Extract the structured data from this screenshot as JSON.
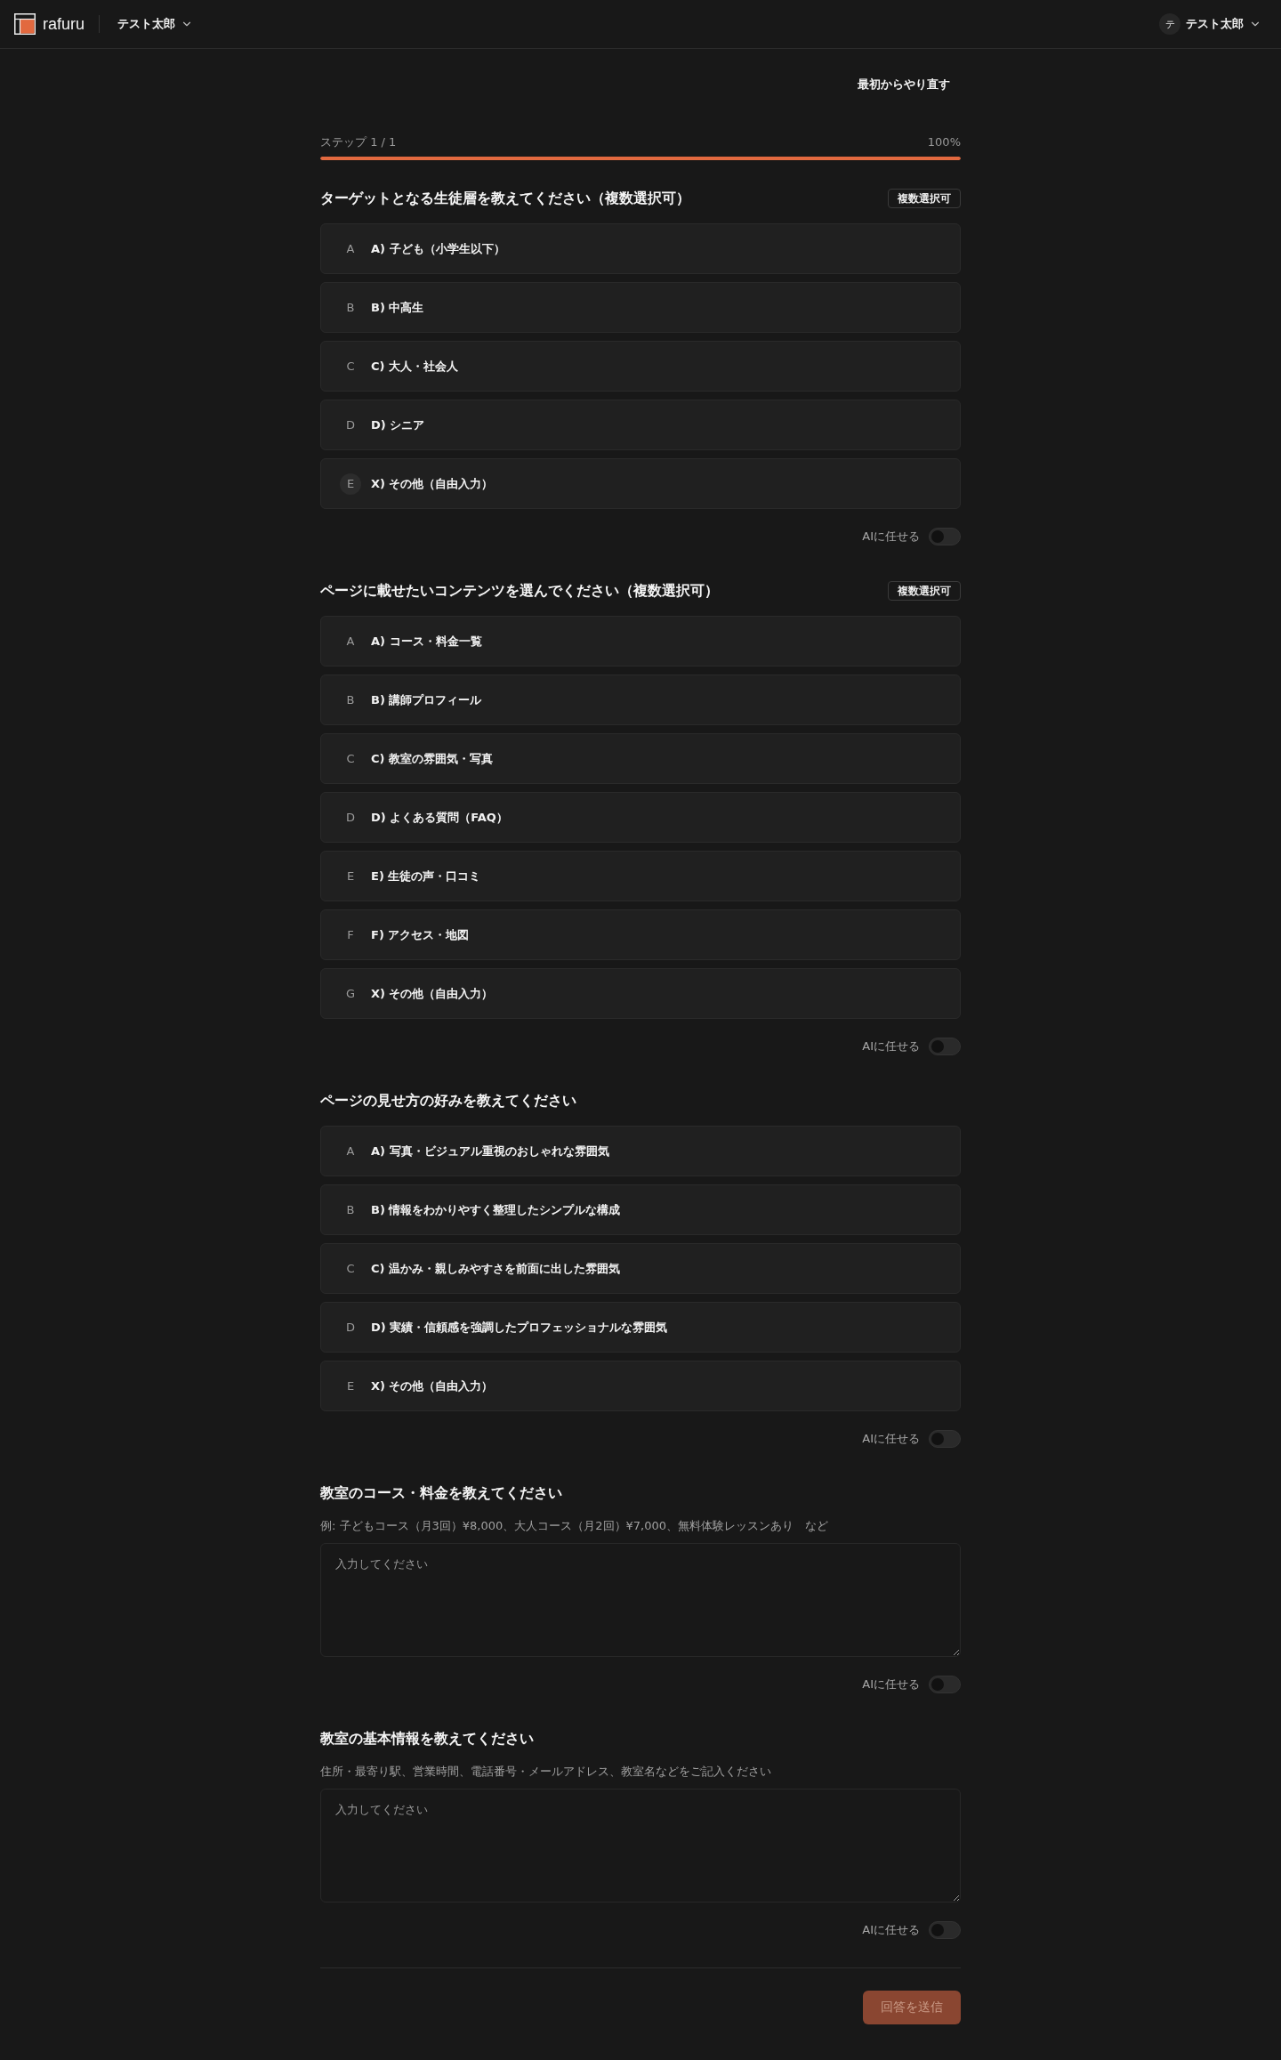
{
  "header": {
    "logo_text": "rafuru",
    "workspace": "テスト太郎",
    "user": {
      "initial": "テ",
      "name": "テスト太郎"
    }
  },
  "restart_button": "最初からやり直す",
  "progress": {
    "label": "ステップ 1 / 1",
    "percent": "100%",
    "level": 1
  },
  "questions": [
    {
      "kind": "choice",
      "title": "ターゲットとなる生徒層を教えてください（複数選択可）",
      "badge": "複数選択可",
      "options": [
        {
          "letter": "A",
          "text": "A) 子ども（小学生以下）",
          "selected": false,
          "hovered": false
        },
        {
          "letter": "B",
          "text": "B) 中高生",
          "selected": false,
          "hovered": false
        },
        {
          "letter": "C",
          "text": "C) 大人・社会人",
          "selected": false,
          "hovered": false
        },
        {
          "letter": "D",
          "text": "D) シニア",
          "selected": false,
          "hovered": false
        },
        {
          "letter": "E",
          "text": "X) その他（自由入力）",
          "selected": false,
          "hovered": true
        }
      ],
      "ai_toggle": {
        "label": "AIに任せる",
        "on": false
      }
    },
    {
      "kind": "choice",
      "title": "ページに載せたいコンテンツを選んでください（複数選択可）",
      "badge": "複数選択可",
      "options": [
        {
          "letter": "A",
          "text": "A) コース・料金一覧",
          "selected": false
        },
        {
          "letter": "B",
          "text": "B) 講師プロフィール",
          "selected": false
        },
        {
          "letter": "C",
          "text": "C) 教室の雰囲気・写真",
          "selected": false
        },
        {
          "letter": "D",
          "text": "D) よくある質問（FAQ）",
          "selected": false
        },
        {
          "letter": "E",
          "text": "E) 生徒の声・口コミ",
          "selected": false
        },
        {
          "letter": "F",
          "text": "F) アクセス・地図",
          "selected": false
        },
        {
          "letter": "G",
          "text": "X) その他（自由入力）",
          "selected": false
        }
      ],
      "ai_toggle": {
        "label": "AIに任せる",
        "on": false
      }
    },
    {
      "kind": "choice",
      "title": "ページの見せ方の好みを教えてください",
      "options": [
        {
          "letter": "A",
          "text": "A) 写真・ビジュアル重視のおしゃれな雰囲気",
          "selected": false
        },
        {
          "letter": "B",
          "text": "B) 情報をわかりやすく整理したシンプルな構成",
          "selected": false
        },
        {
          "letter": "C",
          "text": "C) 温かみ・親しみやすさを前面に出した雰囲気",
          "selected": false
        },
        {
          "letter": "D",
          "text": "D) 実績・信頼感を強調したプロフェッショナルな雰囲気",
          "selected": false
        },
        {
          "letter": "E",
          "text": "X) その他（自由入力）",
          "selected": false
        }
      ],
      "ai_toggle": {
        "label": "AIに任せる",
        "on": false
      }
    },
    {
      "kind": "text",
      "title": "教室のコース・料金を教えてください",
      "hint": "例: 子どもコース（月3回）¥8,000、大人コース（月2回）¥7,000、無料体験レッスンあり　など",
      "placeholder": "入力してください",
      "ai_toggle": {
        "label": "AIに任せる",
        "on": false
      }
    },
    {
      "kind": "text",
      "title": "教室の基本情報を教えてください",
      "hint": "住所・最寄り駅、営業時間、電話番号・メールアドレス、教室名などをご記入ください",
      "placeholder": "入力してください",
      "ai_toggle": {
        "label": "AIに任せる",
        "on": false
      }
    }
  ],
  "submit": {
    "label": "回答を送信",
    "disabled": true
  }
}
